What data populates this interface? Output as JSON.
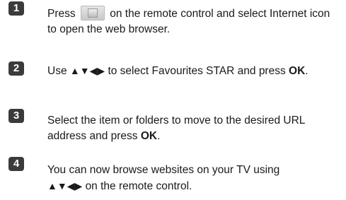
{
  "steps": [
    {
      "number": "1",
      "text_before": "Press",
      "text_after": "on the remote control and select Internet icon to open the web browser."
    },
    {
      "number": "2",
      "text_before": "Use",
      "arrows": "▲▼◀▶",
      "text_middle": "to select Favourites STAR and press",
      "bold": "OK",
      "text_after": "."
    },
    {
      "number": "3",
      "text_before": "Select the item or folders to move to the desired URL address and press",
      "bold": "OK",
      "text_after": "."
    },
    {
      "number": "4",
      "text_before": "You can now browse websites on your TV using",
      "arrows": "▲▼◀▶",
      "text_after": "on the remote control."
    }
  ],
  "icons": {
    "remote_button": "remote-home-button-icon"
  }
}
